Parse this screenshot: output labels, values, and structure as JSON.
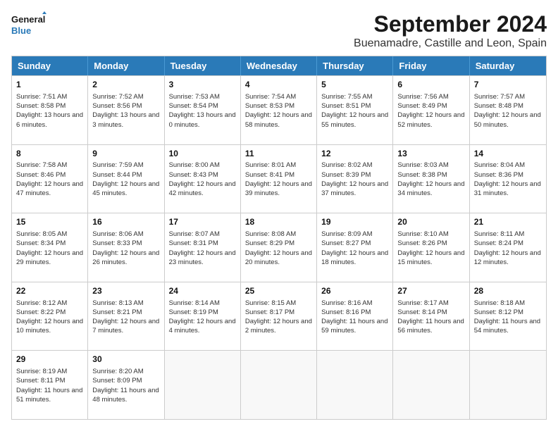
{
  "logo": {
    "line1": "General",
    "line2": "Blue"
  },
  "title": "September 2024",
  "subtitle": "Buenamadre, Castille and Leon, Spain",
  "headers": [
    "Sunday",
    "Monday",
    "Tuesday",
    "Wednesday",
    "Thursday",
    "Friday",
    "Saturday"
  ],
  "weeks": [
    [
      {
        "day": "1",
        "sunrise": "Sunrise: 7:51 AM",
        "sunset": "Sunset: 8:58 PM",
        "daylight": "Daylight: 13 hours and 6 minutes."
      },
      {
        "day": "2",
        "sunrise": "Sunrise: 7:52 AM",
        "sunset": "Sunset: 8:56 PM",
        "daylight": "Daylight: 13 hours and 3 minutes."
      },
      {
        "day": "3",
        "sunrise": "Sunrise: 7:53 AM",
        "sunset": "Sunset: 8:54 PM",
        "daylight": "Daylight: 13 hours and 0 minutes."
      },
      {
        "day": "4",
        "sunrise": "Sunrise: 7:54 AM",
        "sunset": "Sunset: 8:53 PM",
        "daylight": "Daylight: 12 hours and 58 minutes."
      },
      {
        "day": "5",
        "sunrise": "Sunrise: 7:55 AM",
        "sunset": "Sunset: 8:51 PM",
        "daylight": "Daylight: 12 hours and 55 minutes."
      },
      {
        "day": "6",
        "sunrise": "Sunrise: 7:56 AM",
        "sunset": "Sunset: 8:49 PM",
        "daylight": "Daylight: 12 hours and 52 minutes."
      },
      {
        "day": "7",
        "sunrise": "Sunrise: 7:57 AM",
        "sunset": "Sunset: 8:48 PM",
        "daylight": "Daylight: 12 hours and 50 minutes."
      }
    ],
    [
      {
        "day": "8",
        "sunrise": "Sunrise: 7:58 AM",
        "sunset": "Sunset: 8:46 PM",
        "daylight": "Daylight: 12 hours and 47 minutes."
      },
      {
        "day": "9",
        "sunrise": "Sunrise: 7:59 AM",
        "sunset": "Sunset: 8:44 PM",
        "daylight": "Daylight: 12 hours and 45 minutes."
      },
      {
        "day": "10",
        "sunrise": "Sunrise: 8:00 AM",
        "sunset": "Sunset: 8:43 PM",
        "daylight": "Daylight: 12 hours and 42 minutes."
      },
      {
        "day": "11",
        "sunrise": "Sunrise: 8:01 AM",
        "sunset": "Sunset: 8:41 PM",
        "daylight": "Daylight: 12 hours and 39 minutes."
      },
      {
        "day": "12",
        "sunrise": "Sunrise: 8:02 AM",
        "sunset": "Sunset: 8:39 PM",
        "daylight": "Daylight: 12 hours and 37 minutes."
      },
      {
        "day": "13",
        "sunrise": "Sunrise: 8:03 AM",
        "sunset": "Sunset: 8:38 PM",
        "daylight": "Daylight: 12 hours and 34 minutes."
      },
      {
        "day": "14",
        "sunrise": "Sunrise: 8:04 AM",
        "sunset": "Sunset: 8:36 PM",
        "daylight": "Daylight: 12 hours and 31 minutes."
      }
    ],
    [
      {
        "day": "15",
        "sunrise": "Sunrise: 8:05 AM",
        "sunset": "Sunset: 8:34 PM",
        "daylight": "Daylight: 12 hours and 29 minutes."
      },
      {
        "day": "16",
        "sunrise": "Sunrise: 8:06 AM",
        "sunset": "Sunset: 8:33 PM",
        "daylight": "Daylight: 12 hours and 26 minutes."
      },
      {
        "day": "17",
        "sunrise": "Sunrise: 8:07 AM",
        "sunset": "Sunset: 8:31 PM",
        "daylight": "Daylight: 12 hours and 23 minutes."
      },
      {
        "day": "18",
        "sunrise": "Sunrise: 8:08 AM",
        "sunset": "Sunset: 8:29 PM",
        "daylight": "Daylight: 12 hours and 20 minutes."
      },
      {
        "day": "19",
        "sunrise": "Sunrise: 8:09 AM",
        "sunset": "Sunset: 8:27 PM",
        "daylight": "Daylight: 12 hours and 18 minutes."
      },
      {
        "day": "20",
        "sunrise": "Sunrise: 8:10 AM",
        "sunset": "Sunset: 8:26 PM",
        "daylight": "Daylight: 12 hours and 15 minutes."
      },
      {
        "day": "21",
        "sunrise": "Sunrise: 8:11 AM",
        "sunset": "Sunset: 8:24 PM",
        "daylight": "Daylight: 12 hours and 12 minutes."
      }
    ],
    [
      {
        "day": "22",
        "sunrise": "Sunrise: 8:12 AM",
        "sunset": "Sunset: 8:22 PM",
        "daylight": "Daylight: 12 hours and 10 minutes."
      },
      {
        "day": "23",
        "sunrise": "Sunrise: 8:13 AM",
        "sunset": "Sunset: 8:21 PM",
        "daylight": "Daylight: 12 hours and 7 minutes."
      },
      {
        "day": "24",
        "sunrise": "Sunrise: 8:14 AM",
        "sunset": "Sunset: 8:19 PM",
        "daylight": "Daylight: 12 hours and 4 minutes."
      },
      {
        "day": "25",
        "sunrise": "Sunrise: 8:15 AM",
        "sunset": "Sunset: 8:17 PM",
        "daylight": "Daylight: 12 hours and 2 minutes."
      },
      {
        "day": "26",
        "sunrise": "Sunrise: 8:16 AM",
        "sunset": "Sunset: 8:16 PM",
        "daylight": "Daylight: 11 hours and 59 minutes."
      },
      {
        "day": "27",
        "sunrise": "Sunrise: 8:17 AM",
        "sunset": "Sunset: 8:14 PM",
        "daylight": "Daylight: 11 hours and 56 minutes."
      },
      {
        "day": "28",
        "sunrise": "Sunrise: 8:18 AM",
        "sunset": "Sunset: 8:12 PM",
        "daylight": "Daylight: 11 hours and 54 minutes."
      }
    ],
    [
      {
        "day": "29",
        "sunrise": "Sunrise: 8:19 AM",
        "sunset": "Sunset: 8:11 PM",
        "daylight": "Daylight: 11 hours and 51 minutes."
      },
      {
        "day": "30",
        "sunrise": "Sunrise: 8:20 AM",
        "sunset": "Sunset: 8:09 PM",
        "daylight": "Daylight: 11 hours and 48 minutes."
      },
      {
        "day": "",
        "sunrise": "",
        "sunset": "",
        "daylight": ""
      },
      {
        "day": "",
        "sunrise": "",
        "sunset": "",
        "daylight": ""
      },
      {
        "day": "",
        "sunrise": "",
        "sunset": "",
        "daylight": ""
      },
      {
        "day": "",
        "sunrise": "",
        "sunset": "",
        "daylight": ""
      },
      {
        "day": "",
        "sunrise": "",
        "sunset": "",
        "daylight": ""
      }
    ]
  ]
}
